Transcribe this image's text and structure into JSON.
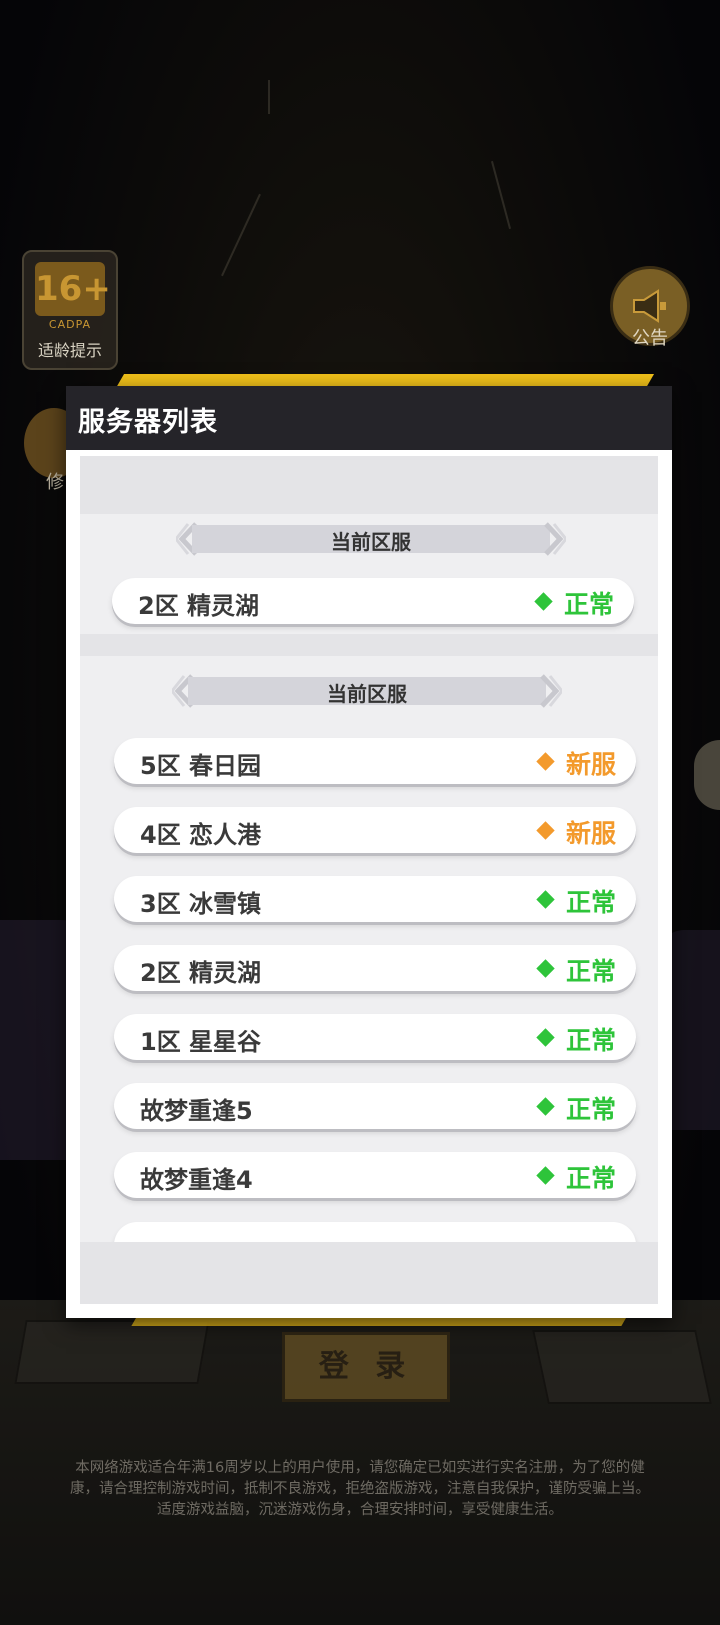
{
  "overlay": {
    "age_rating": "16+",
    "age_code": "CADPA",
    "age_tip": "适龄提示",
    "notice_label": "公告",
    "left_button_label": "修",
    "login_label": "登 录"
  },
  "panel": {
    "title": "服务器列表",
    "current_section_label": "当前区服",
    "list_section_label": "当前区服",
    "current_server": {
      "name": "2区 精灵湖",
      "status": "正常",
      "status_color": "#2ec43a"
    },
    "servers": [
      {
        "name": "5区 春日园",
        "status": "新服",
        "status_color": "#f39a2c"
      },
      {
        "name": "4区 恋人港",
        "status": "新服",
        "status_color": "#f39a2c"
      },
      {
        "name": "3区 冰雪镇",
        "status": "正常",
        "status_color": "#2ec43a"
      },
      {
        "name": "2区 精灵湖",
        "status": "正常",
        "status_color": "#2ec43a"
      },
      {
        "name": "1区 星星谷",
        "status": "正常",
        "status_color": "#2ec43a"
      },
      {
        "name": "故梦重逢5",
        "status": "正常",
        "status_color": "#2ec43a"
      },
      {
        "name": "故梦重逢4",
        "status": "正常",
        "status_color": "#2ec43a"
      }
    ]
  },
  "disclaimer": {
    "line1": "本网络游戏适合年满16周岁以上的用户使用，请您确定已如实进行实名注册，为了您的健",
    "line2": "康，请合理控制游戏时间，抵制不良游戏，拒绝盗版游戏，注意自我保护，谨防受骗上当。",
    "line3": "适度游戏益脑，沉迷游戏伤身，合理安排时间，享受健康生活。"
  }
}
